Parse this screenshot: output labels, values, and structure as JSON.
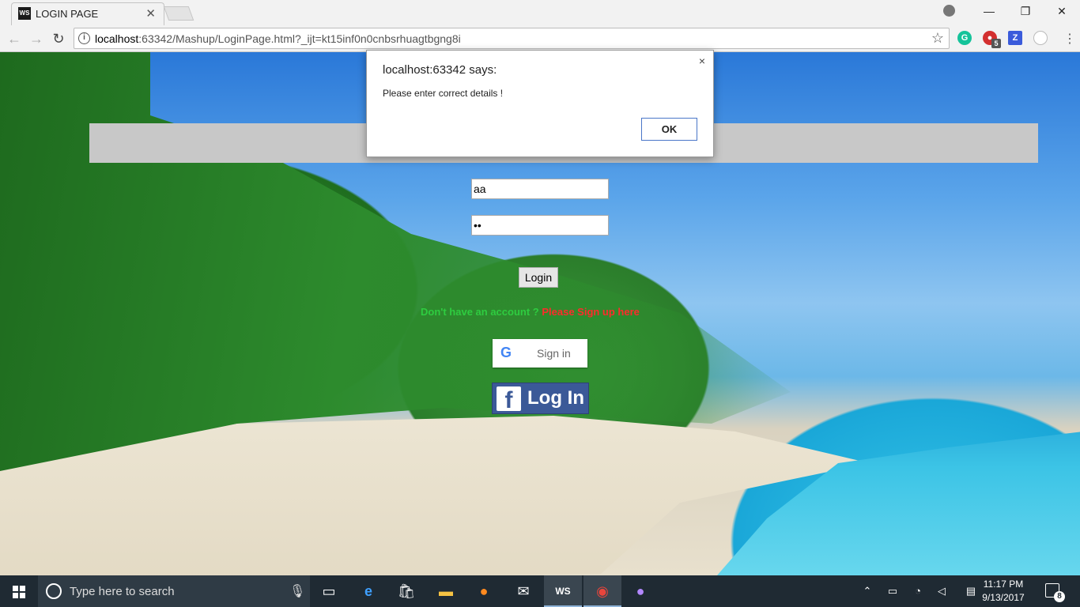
{
  "browser": {
    "tab_title": "LOGIN PAGE",
    "tab_favicon_text": "WS",
    "url_host": "localhost",
    "url_rest": ":63342/Mashup/LoginPage.html?_ijt=kt15inf0n0cnbsrhuagtbgng8i",
    "extension_badge": "5",
    "colors": {
      "chrome_bg": "#f2f2f2",
      "ext_grammarly": "#15c39a",
      "ext_red": "#d32f2f",
      "ext_z": "#3b5bdb"
    }
  },
  "page": {
    "username_value": "aa",
    "password_value": "••",
    "login_label": "Login",
    "signup_question": "Don't have an account ? ",
    "signup_link": "Please Sign up here",
    "google_label": "Sign in",
    "facebook_label": "Log In",
    "colors": {
      "banner": "#c8c8c8",
      "signup_question": "#2ecc40",
      "signup_link": "#ff2b2b",
      "facebook": "#3b5998"
    }
  },
  "dialog": {
    "title": "localhost:63342 says:",
    "message": "Please enter correct details !",
    "ok_label": "OK",
    "close_label": "×"
  },
  "taskbar": {
    "search_placeholder": "Type here to search",
    "time": "11:17 PM",
    "date": "9/13/2017",
    "notification_count": "8",
    "pinned_icons": [
      "task-view-icon",
      "edge-icon",
      "store-icon",
      "file-explorer-icon",
      "firefox-icon",
      "mail-icon",
      "webstorm-icon",
      "chrome-icon",
      "github-icon"
    ]
  }
}
